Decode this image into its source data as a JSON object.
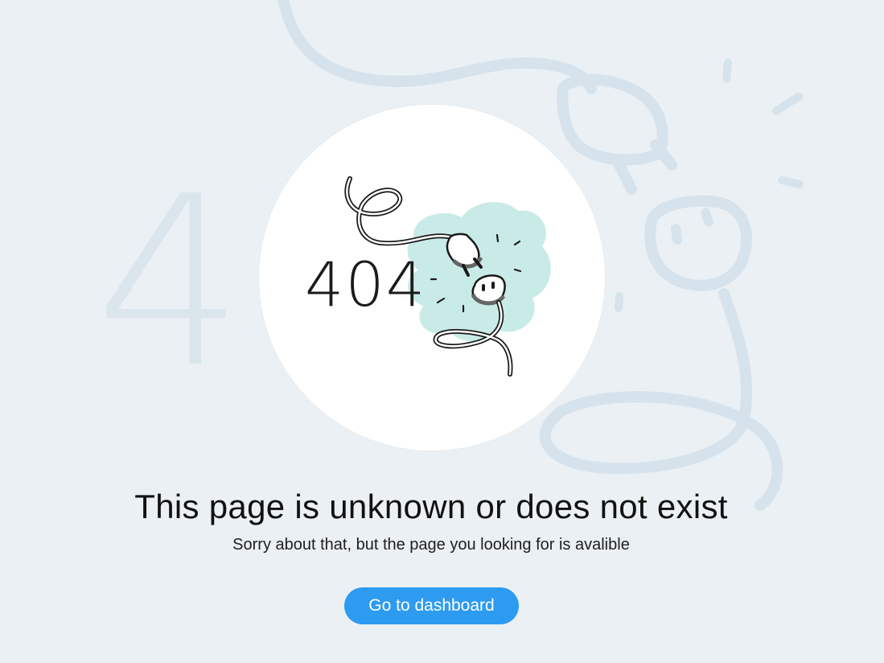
{
  "illustration": {
    "background_code": "404",
    "code": "404",
    "icon": "unplugged-cable-icon"
  },
  "error": {
    "title": "This page is unknown or does not exist",
    "subtitle": "Sorry about that, but the page you looking for is avalible"
  },
  "actions": {
    "dashboard_label": "Go to dashboard"
  },
  "colors": {
    "background": "#ebf0f4",
    "accent": "#2d9bf0",
    "splash": "#c9ebe8",
    "faded_outline": "#d6e3ec"
  }
}
